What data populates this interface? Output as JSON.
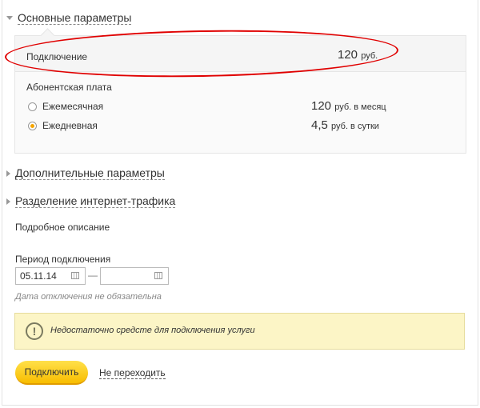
{
  "sections": {
    "main": "Основные параметры",
    "extra": "Дополнительные параметры",
    "traffic": "Разделение интернет-трафика"
  },
  "connection": {
    "label": "Подключение",
    "price_value": "120",
    "price_unit": "руб."
  },
  "fee": {
    "label": "Абонентская плата",
    "options": [
      {
        "label": "Ежемесячная",
        "price_value": "120",
        "price_unit": "руб. в месяц",
        "selected": false
      },
      {
        "label": "Ежедневная",
        "price_value": "4,5",
        "price_unit": "руб. в сутки",
        "selected": true
      }
    ]
  },
  "details_link": "Подробное описание",
  "period": {
    "label": "Период подключения",
    "start_date": "05.11.14",
    "end_date": "",
    "separator": "—",
    "hint": "Дата отключения не обязательна"
  },
  "alert": {
    "icon": "exclamation-circle-icon",
    "text": "Недостаточно средсте для подключения услуги"
  },
  "actions": {
    "connect": "Подключить",
    "skip": "Не переходить"
  },
  "colors": {
    "annotation": "#e00000",
    "button": "#f8bd00",
    "alert_bg": "#fcf5c6",
    "radio_selected": "#f5a400"
  }
}
